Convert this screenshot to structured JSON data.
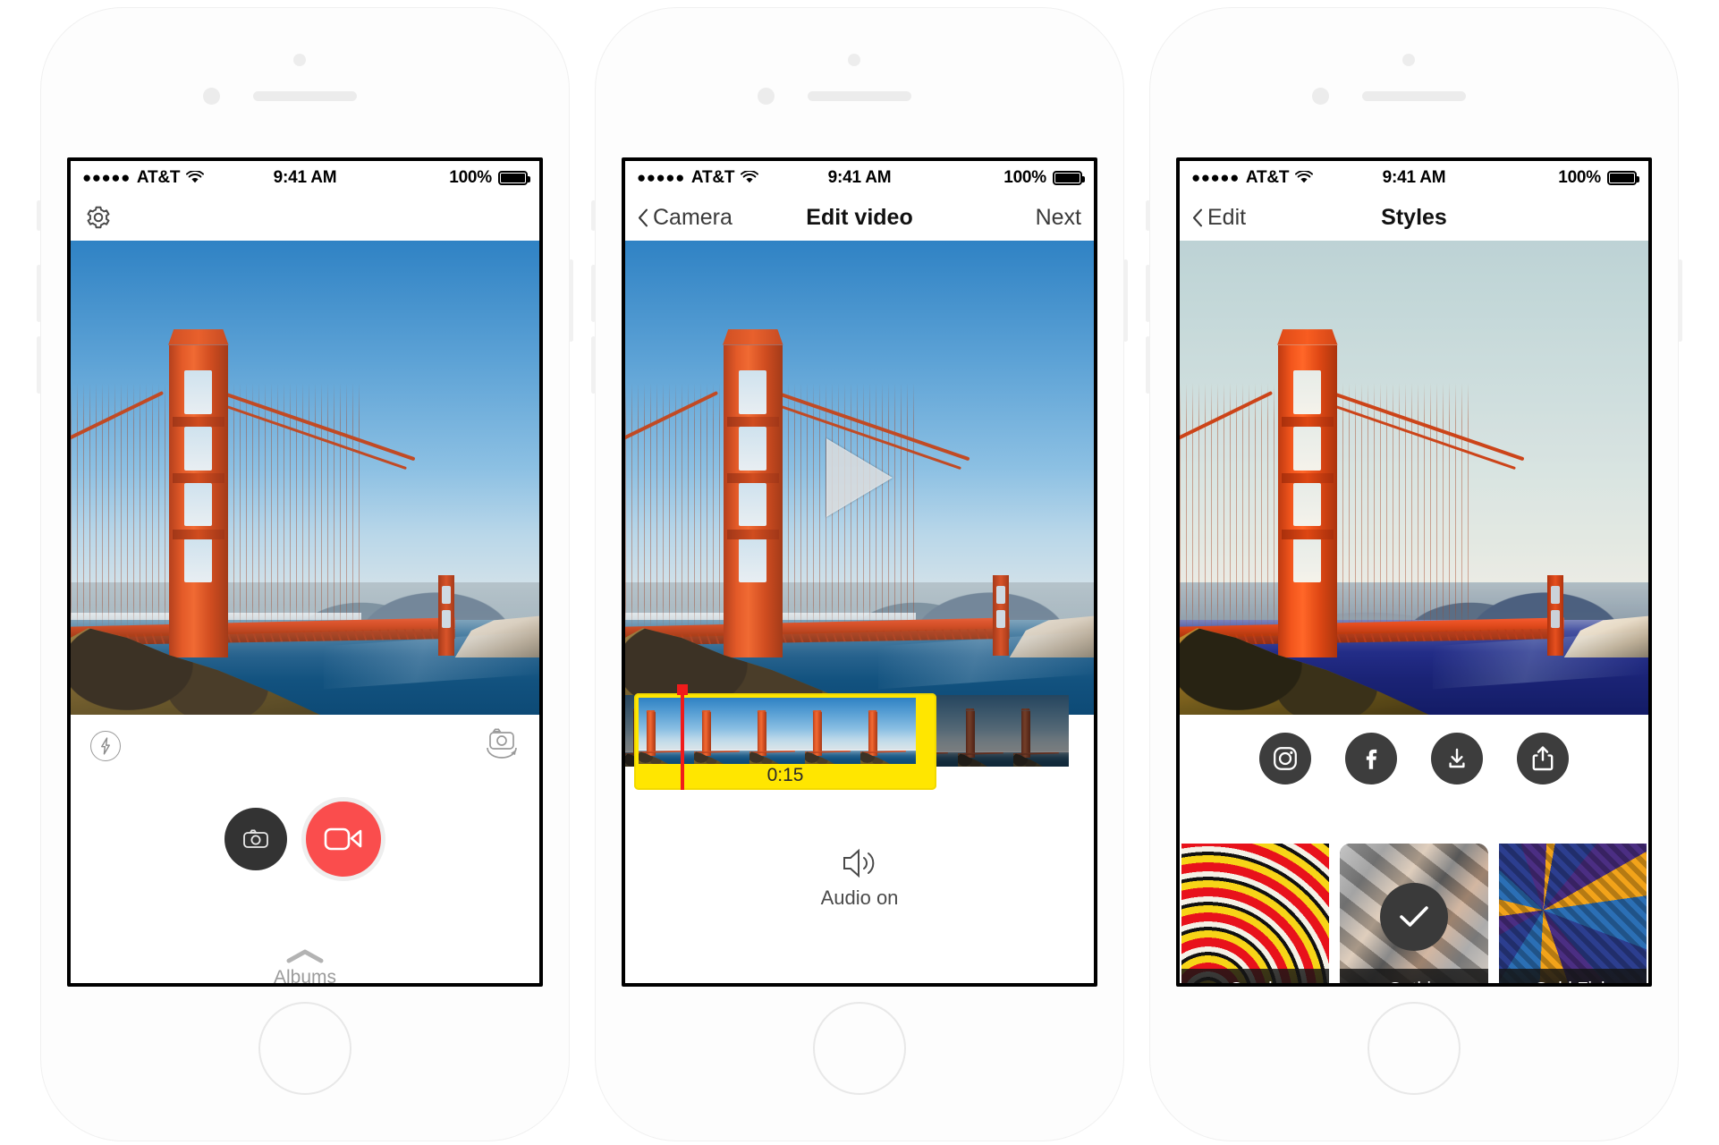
{
  "status_bar": {
    "carrier_dots": "●●●●●",
    "carrier": "AT&T",
    "wifi_icon": "wifi-icon",
    "time": "9:41 AM",
    "battery_percent": "100%",
    "battery_icon": "battery-full-icon"
  },
  "phones": [
    {
      "id": "camera",
      "navbar": {
        "gear_icon": "gear-icon"
      },
      "controls": {
        "flash_icon": "flash-bolt-icon",
        "flip_icon": "camera-flip-icon",
        "photo_button_icon": "camera-icon",
        "record_button_icon": "video-camera-icon",
        "albums_chevron_icon": "chevron-up-icon",
        "albums_label": "Albums"
      }
    },
    {
      "id": "edit-video",
      "navbar": {
        "back_icon": "chevron-left-icon",
        "back_label": "Camera",
        "title": "Edit video",
        "next_label": "Next"
      },
      "player": {
        "play_icon": "play-icon"
      },
      "timeline": {
        "duration": "0:15",
        "frames_total": 8,
        "frames_selected": 5,
        "selection_color": "#ffe600",
        "playhead_color": "#f01b1b"
      },
      "audio": {
        "icon": "speaker-on-icon",
        "label": "Audio on"
      }
    },
    {
      "id": "styles",
      "navbar": {
        "back_icon": "chevron-left-icon",
        "back_label": "Edit",
        "title": "Styles"
      },
      "share": [
        {
          "name": "instagram-share-button",
          "icon": "instagram-icon"
        },
        {
          "name": "facebook-share-button",
          "icon": "facebook-icon"
        },
        {
          "name": "download-button",
          "icon": "download-icon"
        },
        {
          "name": "share-button",
          "icon": "share-upload-icon"
        }
      ],
      "styles": [
        {
          "label": "Candy",
          "selected": false
        },
        {
          "label": "Gothic",
          "selected": true
        },
        {
          "label": "Gold Fish",
          "selected": false
        }
      ],
      "selected_check_icon": "checkmark-icon"
    }
  ],
  "colors": {
    "record_red": "#fa4d4d",
    "dark_button": "#333333",
    "timeline_yellow": "#ffe600",
    "playhead_red": "#f01b1b",
    "nav_text": "#3a3a3a"
  }
}
